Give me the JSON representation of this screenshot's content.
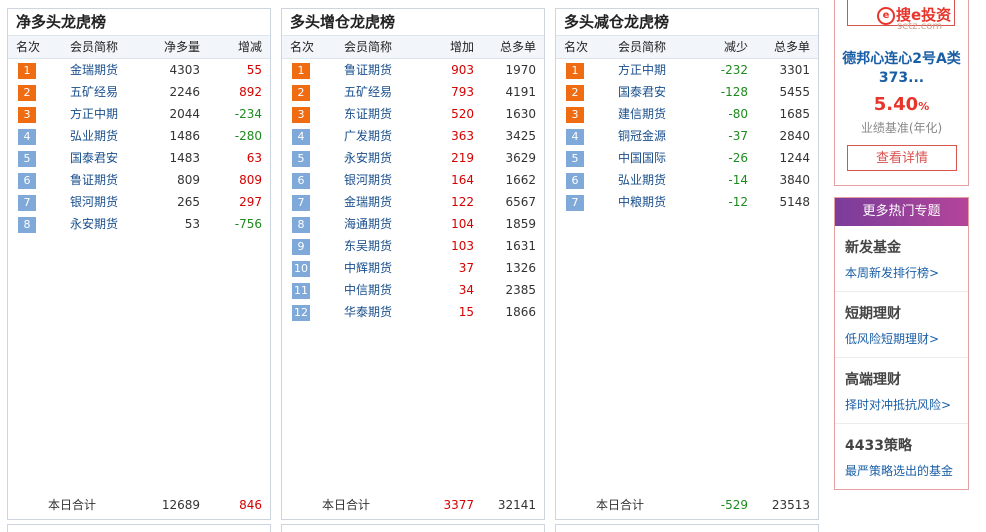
{
  "headers": {
    "rank": "名次",
    "name": "会员简称"
  },
  "panels": [
    {
      "title": "净多头龙虎榜",
      "col3": "净多量",
      "col4": "增减",
      "rows": [
        {
          "rank": "1",
          "name": "金瑞期货",
          "v1": "4303",
          "v2": "55",
          "v2_color": "red"
        },
        {
          "rank": "2",
          "name": "五矿经易",
          "v1": "2246",
          "v2": "892",
          "v2_color": "red"
        },
        {
          "rank": "3",
          "name": "方正中期",
          "v1": "2044",
          "v2": "-234",
          "v2_color": "green"
        },
        {
          "rank": "4",
          "name": "弘业期货",
          "v1": "1486",
          "v2": "-280",
          "v2_color": "green"
        },
        {
          "rank": "5",
          "name": "国泰君安",
          "v1": "1483",
          "v2": "63",
          "v2_color": "red"
        },
        {
          "rank": "6",
          "name": "鲁证期货",
          "v1": "809",
          "v2": "809",
          "v2_color": "red"
        },
        {
          "rank": "7",
          "name": "银河期货",
          "v1": "265",
          "v2": "297",
          "v2_color": "red"
        },
        {
          "rank": "8",
          "name": "永安期货",
          "v1": "53",
          "v2": "-756",
          "v2_color": "green"
        }
      ],
      "total": {
        "label": "本日合计",
        "v1": "12689",
        "v2": "846",
        "v2_color": "red"
      }
    },
    {
      "title": "多头增仓龙虎榜",
      "col3": "增加",
      "col4": "总多单",
      "rows": [
        {
          "rank": "1",
          "name": "鲁证期货",
          "v1": "903",
          "v2": "1970"
        },
        {
          "rank": "2",
          "name": "五矿经易",
          "v1": "793",
          "v2": "4191"
        },
        {
          "rank": "3",
          "name": "东证期货",
          "v1": "520",
          "v2": "1630"
        },
        {
          "rank": "4",
          "name": "广发期货",
          "v1": "363",
          "v2": "3425"
        },
        {
          "rank": "5",
          "name": "永安期货",
          "v1": "219",
          "v2": "3629"
        },
        {
          "rank": "6",
          "name": "银河期货",
          "v1": "164",
          "v2": "1662"
        },
        {
          "rank": "7",
          "name": "金瑞期货",
          "v1": "122",
          "v2": "6567"
        },
        {
          "rank": "8",
          "name": "海通期货",
          "v1": "104",
          "v2": "1859"
        },
        {
          "rank": "9",
          "name": "东吴期货",
          "v1": "103",
          "v2": "1631"
        },
        {
          "rank": "10",
          "name": "中辉期货",
          "v1": "37",
          "v2": "1326"
        },
        {
          "rank": "11",
          "name": "中信期货",
          "v1": "34",
          "v2": "2385"
        },
        {
          "rank": "12",
          "name": "华泰期货",
          "v1": "15",
          "v2": "1866"
        }
      ],
      "v1_color": "red",
      "total": {
        "label": "本日合计",
        "v1": "3377",
        "v2": "32141",
        "v1_color": "red"
      }
    },
    {
      "title": "多头减仓龙虎榜",
      "col3": "减少",
      "col4": "总多单",
      "rows": [
        {
          "rank": "1",
          "name": "方正中期",
          "v1": "-232",
          "v2": "3301"
        },
        {
          "rank": "2",
          "name": "国泰君安",
          "v1": "-128",
          "v2": "5455"
        },
        {
          "rank": "3",
          "name": "建信期货",
          "v1": "-80",
          "v2": "1685"
        },
        {
          "rank": "4",
          "name": "铜冠金源",
          "v1": "-37",
          "v2": "2840"
        },
        {
          "rank": "5",
          "name": "中国国际",
          "v1": "-26",
          "v2": "1244"
        },
        {
          "rank": "6",
          "name": "弘业期货",
          "v1": "-14",
          "v2": "3840"
        },
        {
          "rank": "7",
          "name": "中粮期货",
          "v1": "-12",
          "v2": "5148"
        }
      ],
      "v1_color": "green",
      "total": {
        "label": "本日合计",
        "v1": "-529",
        "v2": "23513",
        "v1_color": "green"
      }
    }
  ],
  "ad": {
    "logo": "搜e投资",
    "logo_mark": "e",
    "logo_sub": "setz.com",
    "fund_name": "德邦心连心2号A类373...",
    "rate": "5.40",
    "rate_unit": "%",
    "rate_desc": "业绩基准(年化)",
    "button": "查看详情"
  },
  "more": {
    "header": "更多热门专题",
    "items": [
      {
        "title": "新发基金",
        "sub": "本周新发排行榜>"
      },
      {
        "title": "短期理财",
        "sub": "低风险短期理财>"
      },
      {
        "title": "高端理财",
        "sub": "择时对冲抵抗风险>"
      },
      {
        "title": "4433策略",
        "sub": "最严策略选出的基金"
      }
    ]
  },
  "colors": {
    "hot_badge": "#f06c13",
    "normal_badge": "#7fa9d8",
    "up": "#d40000",
    "down": "#1d8a1d",
    "link": "#1a4f8c"
  }
}
